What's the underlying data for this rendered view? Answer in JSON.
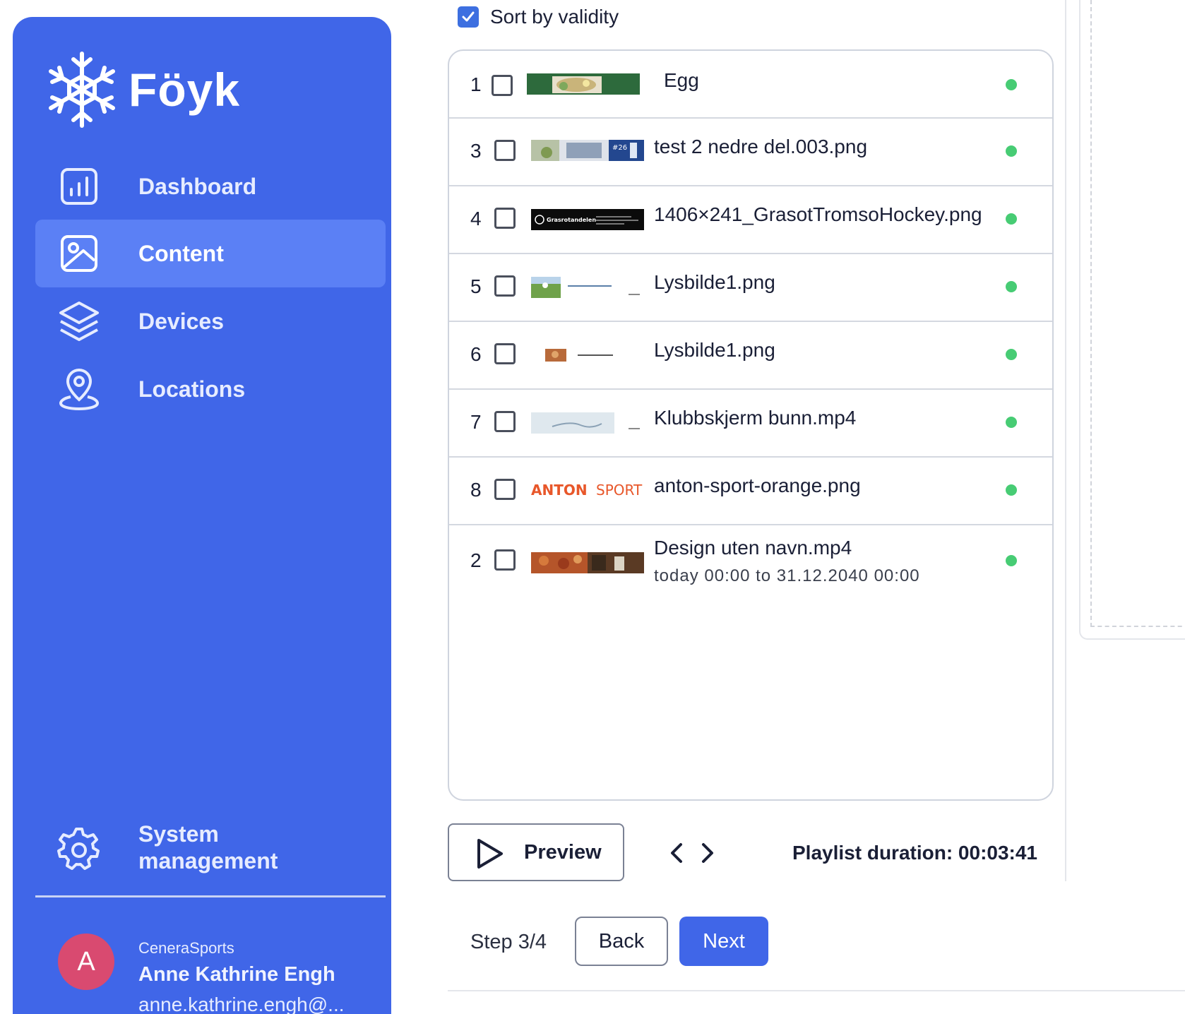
{
  "brand": {
    "name": "Föyk"
  },
  "nav": {
    "items": [
      {
        "label": "Dashboard",
        "icon": "dashboard-chart-icon",
        "active": false
      },
      {
        "label": "Content",
        "icon": "image-icon",
        "active": true
      },
      {
        "label": "Devices",
        "icon": "layers-icon",
        "active": false
      },
      {
        "label": "Locations",
        "icon": "location-pin-icon",
        "active": false
      }
    ],
    "system": {
      "label": "System management",
      "icon": "gear-icon"
    }
  },
  "user": {
    "avatar_letter": "A",
    "org": "CeneraSports",
    "name": "Anne Kathrine Engh",
    "email": "anne.kathrine.engh@..."
  },
  "sort": {
    "label": "Sort by validity",
    "checked": true
  },
  "playlist": {
    "rows": [
      {
        "num": "1",
        "name": "Egg",
        "sub": "",
        "thumb": "food-photo",
        "status": "active"
      },
      {
        "num": "3",
        "name": "test 2 nedre del.003.png",
        "sub": "",
        "thumb": "sports-banner",
        "status": "active"
      },
      {
        "num": "4",
        "name": "1406×241_GrasotTromsoHockey.png",
        "sub": "",
        "thumb": "grasrotandelen-banner",
        "status": "active"
      },
      {
        "num": "5",
        "name": "Lysbilde1.png",
        "sub": "",
        "thumb": "field-banner",
        "status": "active"
      },
      {
        "num": "6",
        "name": "Lysbilde1.png",
        "sub": "",
        "thumb": "small-photo-banner",
        "status": "active"
      },
      {
        "num": "7",
        "name": "Klubbskjerm bunn.mp4",
        "sub": "",
        "thumb": "sky-banner",
        "status": "active"
      },
      {
        "num": "8",
        "name": "anton-sport-orange.png",
        "sub": "",
        "thumb": "anton-sport-logo",
        "status": "active"
      },
      {
        "num": "2",
        "name": "Design uten navn.mp4",
        "sub": "today 00:00 to 31.12.2040 00:00",
        "thumb": "food-market-banner",
        "status": "active"
      }
    ],
    "thumb_text": {
      "grasrot": "Grasrotandelen",
      "anton_bold": "ANTON",
      "anton_light": "SPORT",
      "jersey": "#26"
    }
  },
  "controls": {
    "preview_label": "Preview",
    "duration_label": "Playlist duration: 00:03:41"
  },
  "footer": {
    "step_label": "Step 3/4",
    "back_label": "Back",
    "next_label": "Next"
  },
  "colors": {
    "sidebar": "#4066e8",
    "active_nav": "#5b80f5",
    "status_dot": "#47cc74",
    "avatar": "#d94a70",
    "primary_button": "#4066e8"
  }
}
